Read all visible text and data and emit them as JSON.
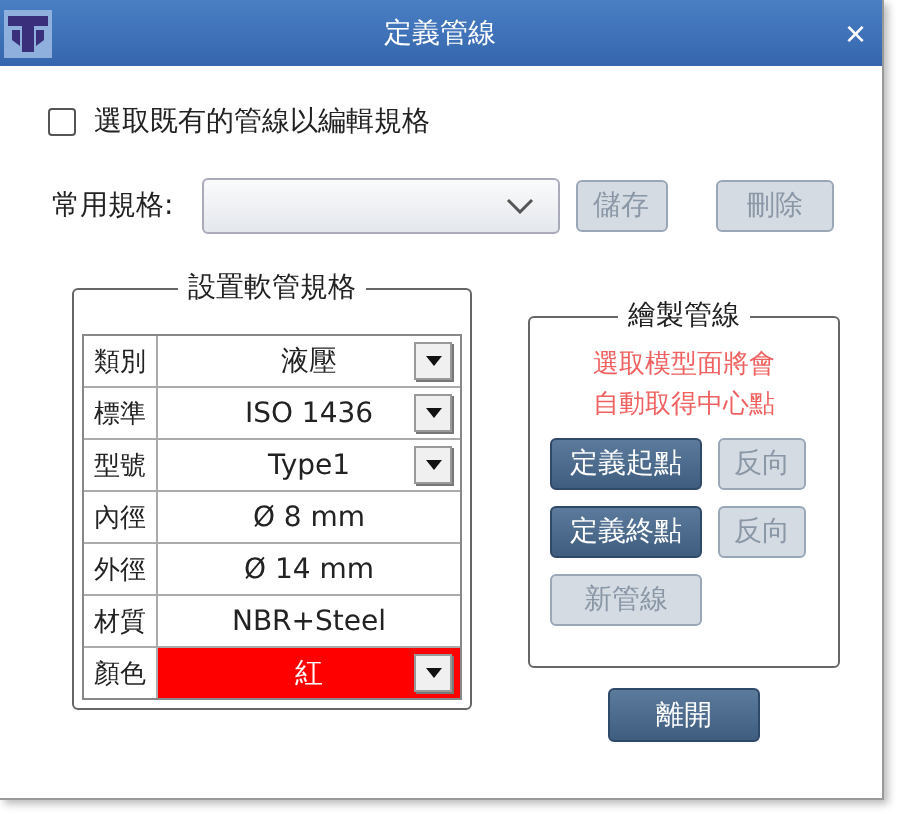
{
  "window": {
    "title": "定義管線",
    "close": "×"
  },
  "select_existing": {
    "label": "選取既有的管線以編輯規格",
    "checked": false
  },
  "common_spec": {
    "label": "常用規格:",
    "buttons": [
      {
        "label": "儲存",
        "disabled": true
      },
      {
        "label": "刪除",
        "disabled": true
      }
    ]
  },
  "hose_spec": {
    "title": "設置軟管規格",
    "rows": [
      {
        "label": "類別",
        "value": "液壓",
        "kind": "dropdown"
      },
      {
        "label": "標準",
        "value": "ISO 1436",
        "kind": "dropdown"
      },
      {
        "label": "型號",
        "value": "Type1",
        "kind": "dropdown"
      },
      {
        "label": "內徑",
        "value": "Ø 8 mm",
        "kind": "text"
      },
      {
        "label": "外徑",
        "value": "Ø 14 mm",
        "kind": "text"
      },
      {
        "label": "材質",
        "value": "NBR+Steel",
        "kind": "text"
      },
      {
        "label": "顏色",
        "value": "紅",
        "kind": "dropdown",
        "color": "#ff0000"
      }
    ]
  },
  "draw_pipe": {
    "title": "繪製管線",
    "hint_lines": [
      "選取模型面將會",
      "自動取得中心點"
    ],
    "buttons": [
      {
        "label": "定義起點",
        "disabled": false
      },
      {
        "label": "反向",
        "disabled": true
      },
      {
        "label": "定義終點",
        "disabled": false
      },
      {
        "label": "反向",
        "disabled": true
      },
      {
        "label": "新管線",
        "disabled": true
      }
    ]
  },
  "close_button": {
    "label": "離開",
    "disabled": false
  }
}
